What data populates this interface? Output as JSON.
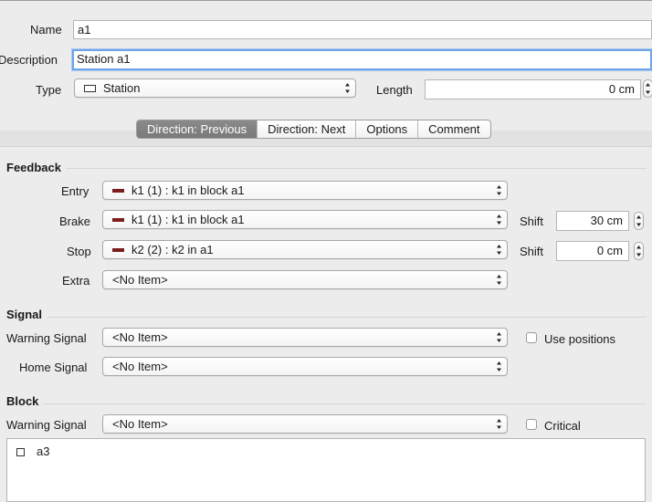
{
  "general": {
    "name_label": "Name",
    "name_value": "a1",
    "description_label": "Description",
    "description_value": "Station a1",
    "type_label": "Type",
    "type_value": "Station",
    "length_label": "Length",
    "length_value": "0 cm"
  },
  "tabs": [
    {
      "label": "Direction: Previous",
      "active": true
    },
    {
      "label": "Direction: Next",
      "active": false
    },
    {
      "label": "Options",
      "active": false
    },
    {
      "label": "Comment",
      "active": false
    }
  ],
  "feedback": {
    "title": "Feedback",
    "entry_label": "Entry",
    "entry_value": "k1 (1) : k1 in block a1",
    "brake_label": "Brake",
    "brake_value": "k1 (1) : k1 in block a1",
    "brake_shift_label": "Shift",
    "brake_shift_value": "30 cm",
    "stop_label": "Stop",
    "stop_value": "k2 (2) : k2 in a1",
    "stop_shift_label": "Shift",
    "stop_shift_value": "0 cm",
    "extra_label": "Extra",
    "extra_value": "<No Item>",
    "sensor_color": "#7a1c1c"
  },
  "signal": {
    "title": "Signal",
    "warning_label": "Warning Signal",
    "warning_value": "<No Item>",
    "use_positions_label": "Use positions",
    "use_positions_checked": false,
    "home_label": "Home Signal",
    "home_value": "<No Item>"
  },
  "block": {
    "title": "Block",
    "warning_label": "Warning Signal",
    "warning_value": "<No Item>",
    "critical_label": "Critical",
    "critical_checked": false,
    "list_items": [
      "a3"
    ]
  }
}
